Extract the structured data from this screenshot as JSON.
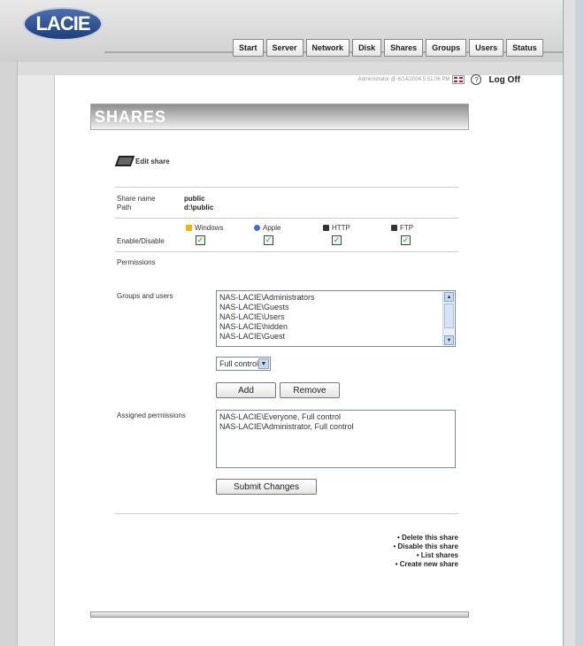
{
  "app": {
    "logo": "LACIE"
  },
  "tabs": [
    "Start",
    "Server",
    "Network",
    "Disk",
    "Shares",
    "Groups",
    "Users",
    "Status"
  ],
  "userbar": {
    "user_info": "Administrator @ 6/14/2004 5:51:06 PM",
    "logoff": "Log Off"
  },
  "page": {
    "title": "SHARES",
    "section": "Edit share"
  },
  "share": {
    "name_label": "Share name",
    "name_value": "public",
    "path_label": "Path",
    "path_value": "d:\\public"
  },
  "services": {
    "label": "Enable/Disable",
    "items": [
      {
        "name": "Windows",
        "checked": true,
        "color": "#f0b400"
      },
      {
        "name": "Apple",
        "checked": true,
        "color": "#3a6fd8"
      },
      {
        "name": "HTTP",
        "checked": true,
        "color": "#333333"
      },
      {
        "name": "FTP",
        "checked": true,
        "color": "#333333"
      }
    ]
  },
  "permissions": {
    "heading": "Permissions",
    "groups_label": "Groups and users",
    "groups": [
      "NAS-LACIE\\Administrators",
      "NAS-LACIE\\Guests",
      "NAS-LACIE\\Users",
      "NAS-LACIE\\hidden",
      "NAS-LACIE\\Guest"
    ],
    "selected_permission": "Full control",
    "add_label": "Add",
    "remove_label": "Remove",
    "assigned_label": "Assigned permissions",
    "assigned": [
      "NAS-LACIE\\Everyone, Full control",
      "NAS-LACIE\\Administrator, Full control"
    ],
    "submit_label": "Submit Changes"
  },
  "links": [
    "• Delete this share",
    "• Disable this share",
    "• List shares",
    "• Create new share"
  ]
}
